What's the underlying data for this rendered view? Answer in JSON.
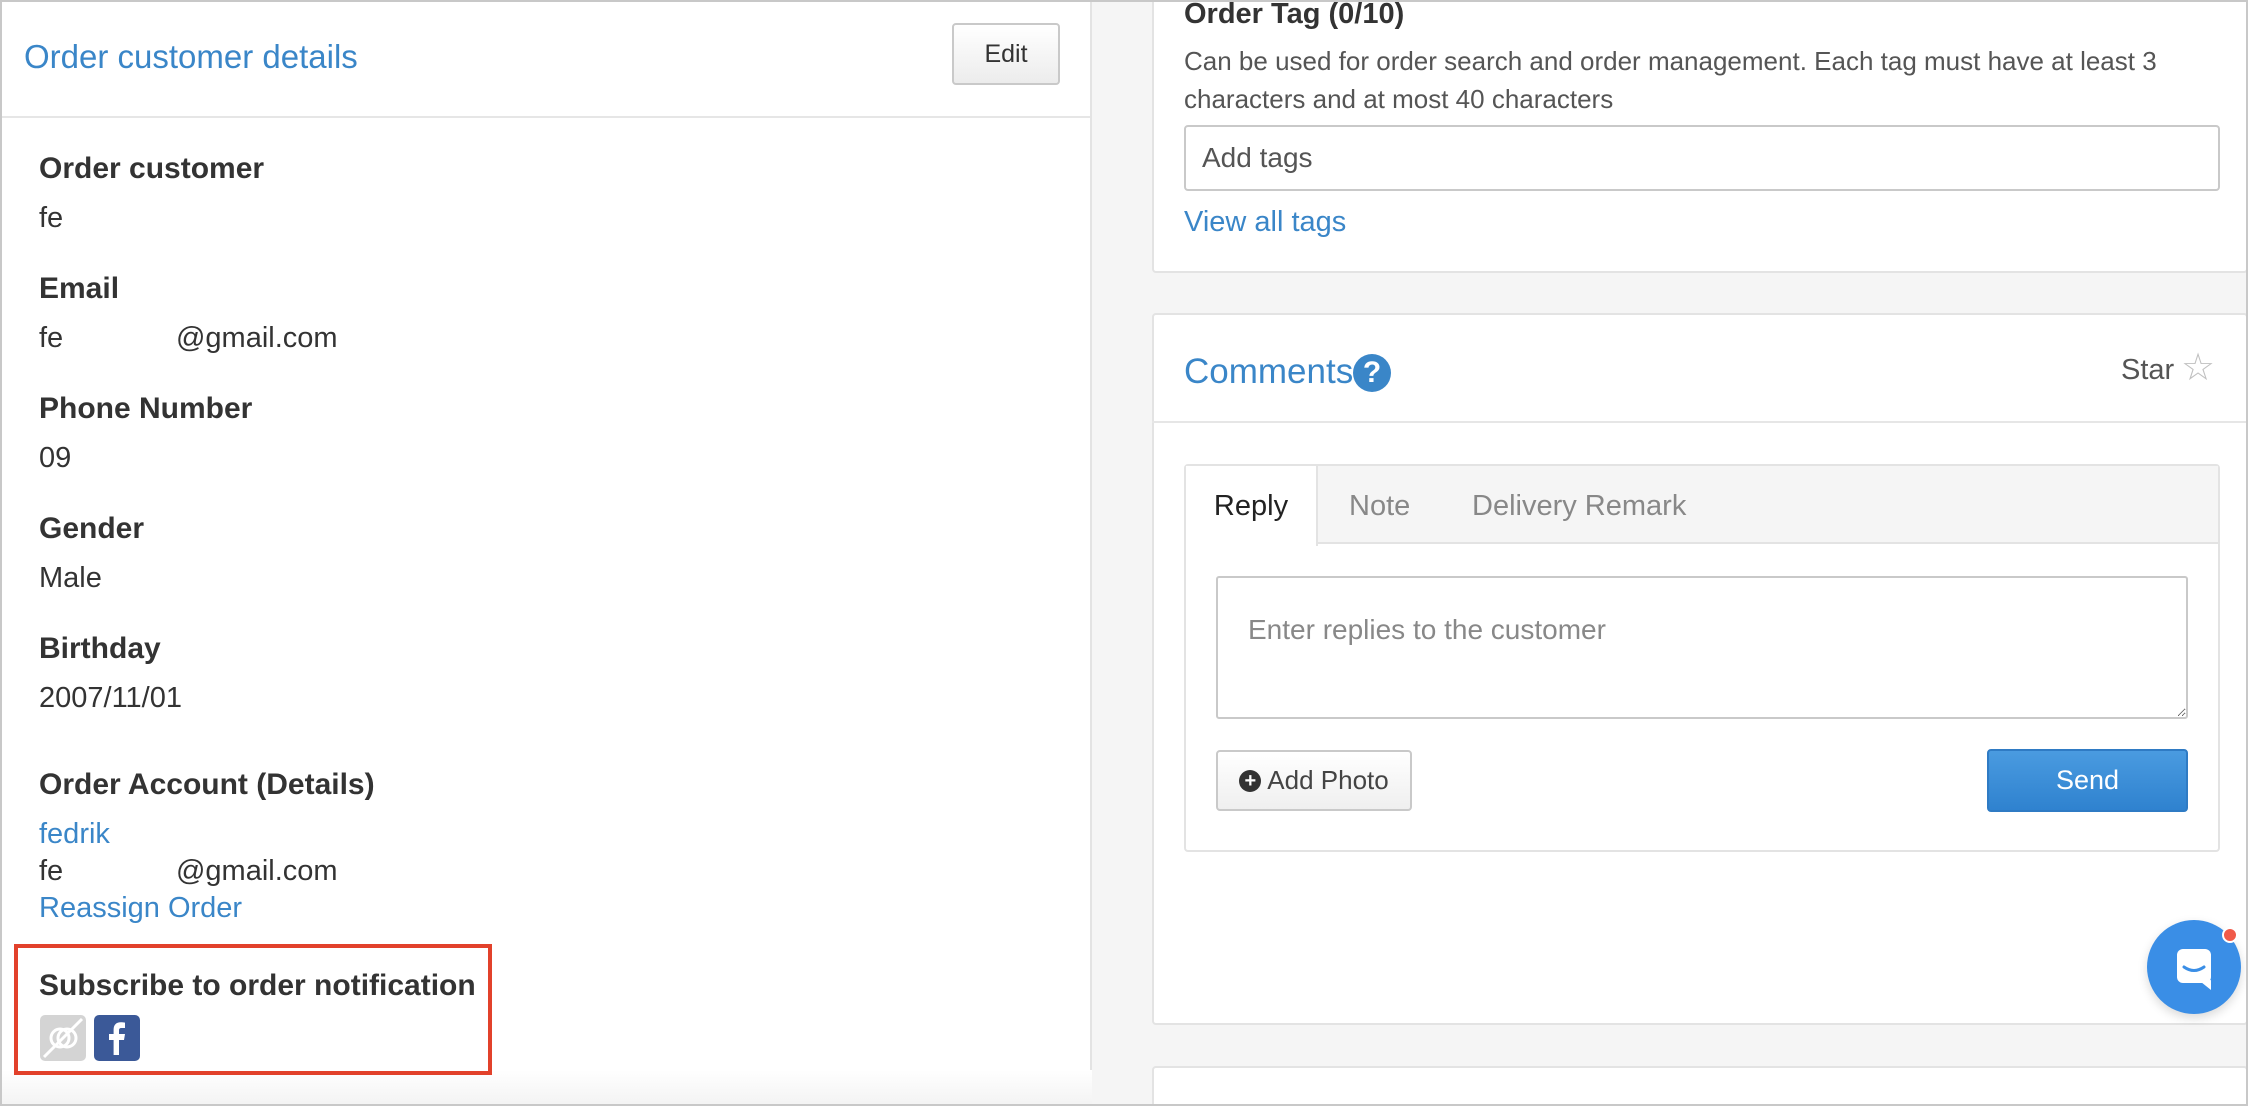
{
  "customer_panel": {
    "title": "Order customer details",
    "edit_label": "Edit",
    "fields": [
      {
        "label": "Order customer",
        "value": "fe"
      },
      {
        "label": "Email",
        "value": "fe              @gmail.com"
      },
      {
        "label": "Phone Number",
        "value": "09"
      },
      {
        "label": "Gender",
        "value": "Male"
      },
      {
        "label": "Birthday",
        "value": "2007/11/01"
      }
    ],
    "account": {
      "label": "Order Account (Details)",
      "name": "fedrik",
      "email": "fe              @gmail.com",
      "reassign": "Reassign Order"
    },
    "subscribe": {
      "label": "Subscribe to order notification",
      "icons": [
        "notification-off-icon",
        "facebook-icon"
      ]
    }
  },
  "tags": {
    "title": "Order Tag (0/10)",
    "description": "Can be used for order search and order management. Each tag must have at least 3 characters and at most 40 characters",
    "placeholder": "Add tags",
    "view_all": "View all tags"
  },
  "comments": {
    "title": "Comments",
    "help_icon": "?",
    "star_label": "Star",
    "star_icon": "☆",
    "tabs": [
      "Reply",
      "Note",
      "Delivery Remark"
    ],
    "active_tab": "Reply",
    "reply_placeholder": "Enter replies to the customer",
    "add_photo_label": "Add Photo",
    "send_label": "Send"
  },
  "colors": {
    "accent": "#3a86c8",
    "highlight": "#e2412b",
    "facebook": "#3b5998"
  }
}
